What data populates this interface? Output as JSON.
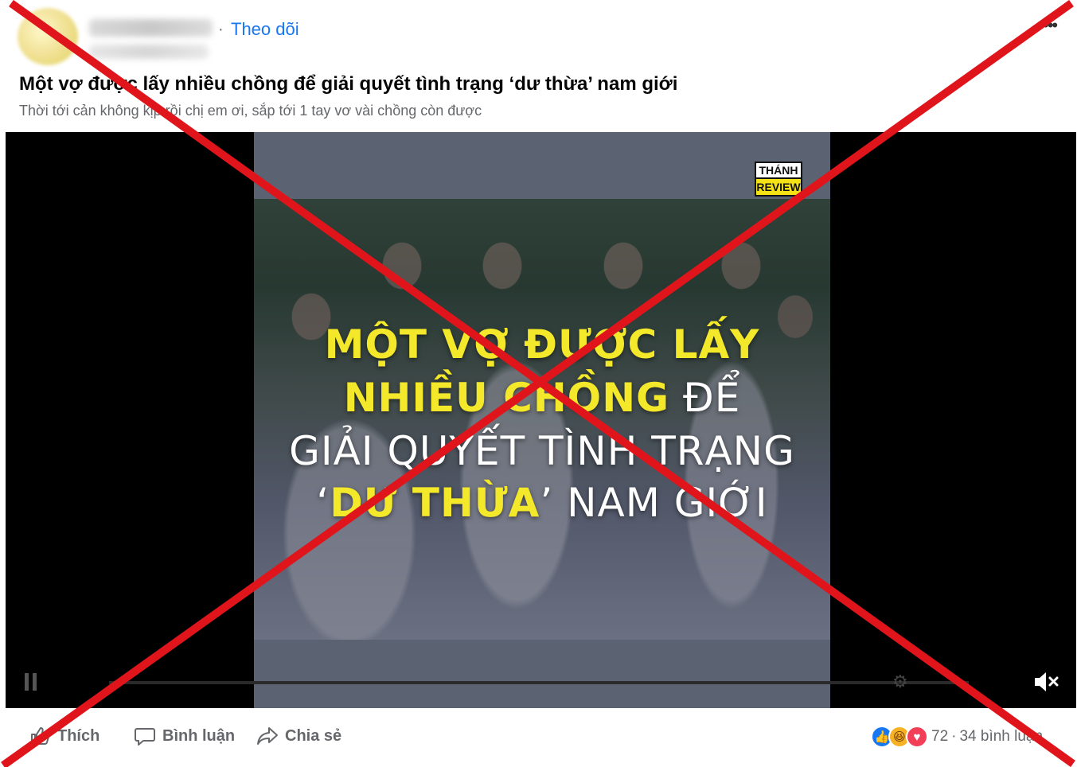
{
  "header": {
    "follow_separator": "·",
    "follow_label": "Theo dõi",
    "more_label": "•••"
  },
  "post": {
    "title": "Một vợ được lấy nhiều chồng để giải quyết tình trạng ‘dư thừa’ nam giới",
    "description": "Thời tới cản không kịp rồi chị em ơi, sắp tới 1 tay vơ vài chồng còn được"
  },
  "video": {
    "logo_top": "THÁNH",
    "logo_bottom": "REVIEW",
    "line1": "MỘT VỢ ĐƯỢC LẤY",
    "line2_yellow": "NHIỀU CHỒNG",
    "line2_white": " ĐỂ",
    "line3": "GIẢI QUYẾT TÌNH TRẠNG",
    "line4_quote_open": "‘",
    "line4_yellow": "DƯ THỪA",
    "line4_white": "’ NAM GIỚI",
    "muted": true,
    "accent_yellow": "#f3e82a"
  },
  "actions": {
    "like_label": "Thích",
    "comment_label": "Bình luận",
    "share_label": "Chia sẻ"
  },
  "stats": {
    "reaction_icons": [
      "like-icon",
      "haha-icon",
      "love-icon"
    ],
    "reaction_count": "72",
    "separator": "·",
    "comment_count": "34 bình luận"
  },
  "overlay": {
    "type": "red-x-mark",
    "color": "#e0151c"
  },
  "colors": {
    "link_blue": "#1877f2",
    "muted_text": "#65676b",
    "video_bg": "#000000"
  }
}
